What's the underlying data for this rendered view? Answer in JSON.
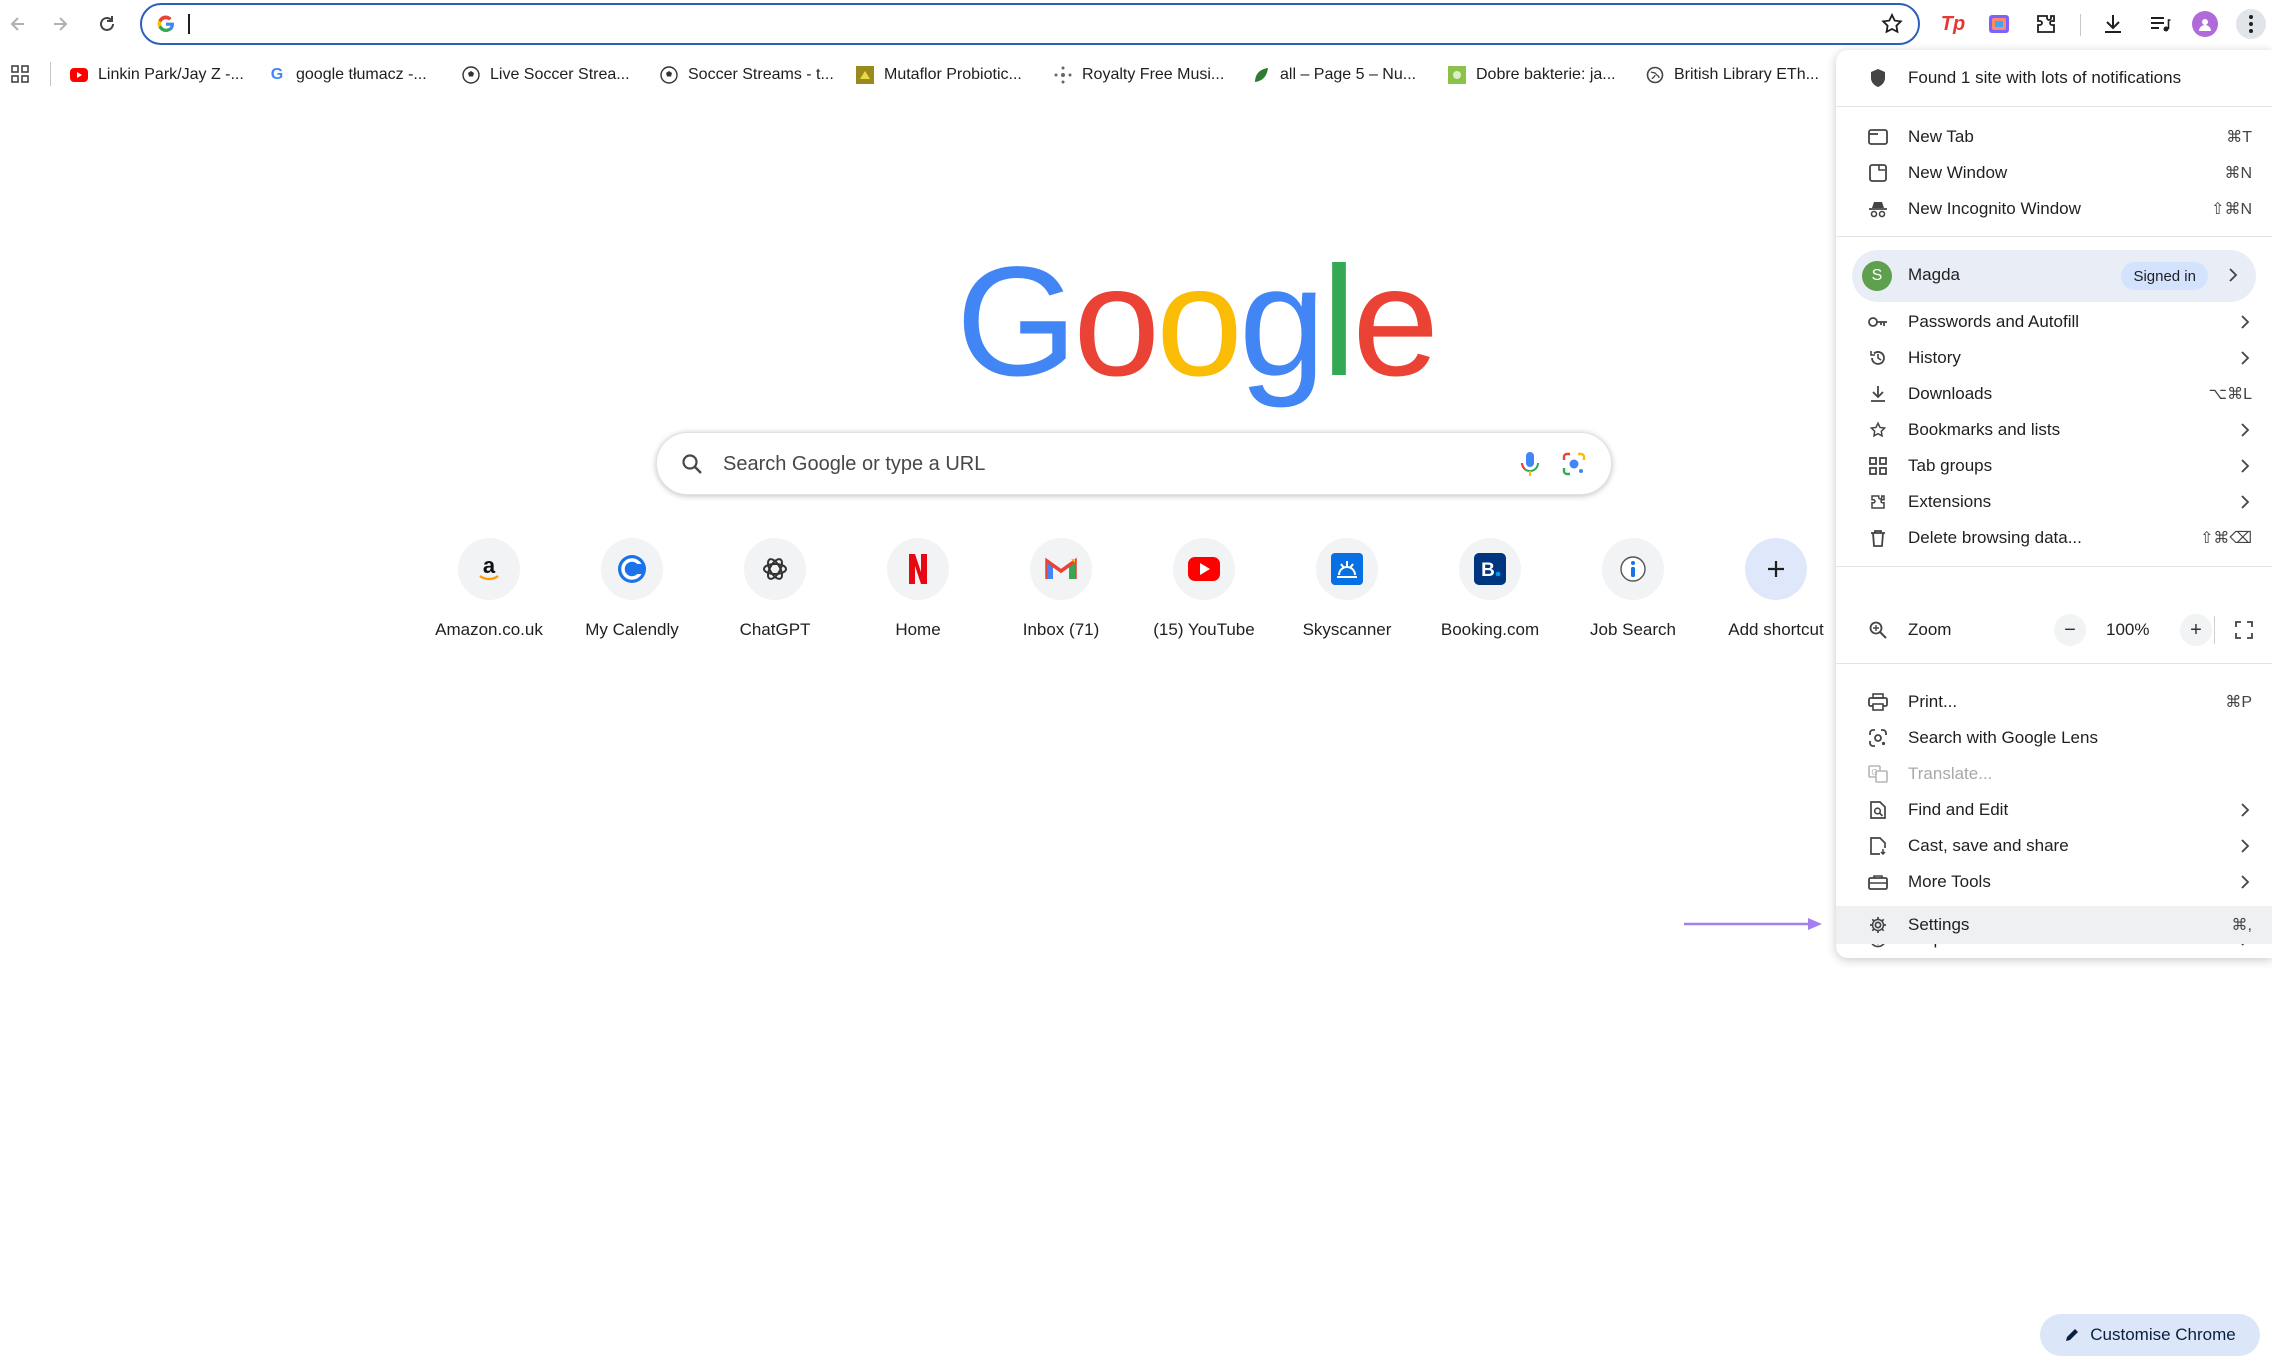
{
  "omnibox": {
    "value": ""
  },
  "bookmarks": [
    {
      "label": "Linkin Park/Jay Z -...",
      "icon": "youtube-icon"
    },
    {
      "label": "google tłumacz -...",
      "icon": "google-icon"
    },
    {
      "label": "Live Soccer Strea...",
      "icon": "soccer-ball-icon"
    },
    {
      "label": "Soccer Streams - t...",
      "icon": "soccer-ball-icon"
    },
    {
      "label": "Mutaflor Probiotic...",
      "icon": "mutaflor-icon"
    },
    {
      "label": "Royalty Free Musi...",
      "icon": "music-icon"
    },
    {
      "label": "all – Page 5 – Nu...",
      "icon": "leaf-icon"
    },
    {
      "label": "Dobre bakterie: ja...",
      "icon": "bacteria-icon"
    },
    {
      "label": "British Library ETh...",
      "icon": "globe-icon"
    }
  ],
  "search": {
    "placeholder": "Search Google or type a URL"
  },
  "shortcuts": [
    {
      "label": "Amazon.co.uk",
      "icon": "amazon-icon"
    },
    {
      "label": "My Calendly",
      "icon": "calendly-icon"
    },
    {
      "label": "ChatGPT",
      "icon": "chatgpt-icon"
    },
    {
      "label": "Home",
      "icon": "netflix-icon"
    },
    {
      "label": "Inbox (71)",
      "icon": "gmail-icon"
    },
    {
      "label": "(15) YouTube",
      "icon": "youtube-icon"
    },
    {
      "label": "Skyscanner",
      "icon": "skyscanner-icon"
    },
    {
      "label": "Booking.com",
      "icon": "booking-icon"
    },
    {
      "label": "Job Search",
      "icon": "job-search-icon"
    },
    {
      "label": "Add shortcut",
      "icon": "plus-icon"
    }
  ],
  "menu": {
    "notification": "Found 1 site with lots of notifications",
    "new_tab": {
      "label": "New Tab",
      "shortcut": "⌘T"
    },
    "new_window": {
      "label": "New Window",
      "shortcut": "⌘N"
    },
    "new_incognito": {
      "label": "New Incognito Window",
      "shortcut": "⇧⌘N"
    },
    "profile": {
      "initial": "S",
      "name": "Magda",
      "status": "Signed in"
    },
    "passwords": {
      "label": "Passwords and Autofill"
    },
    "history": {
      "label": "History"
    },
    "downloads": {
      "label": "Downloads",
      "shortcut": "⌥⌘L"
    },
    "bookmarks": {
      "label": "Bookmarks and lists"
    },
    "tab_groups": {
      "label": "Tab groups"
    },
    "extensions": {
      "label": "Extensions"
    },
    "delete_data": {
      "label": "Delete browsing data...",
      "shortcut": "⇧⌘⌫"
    },
    "zoom": {
      "label": "Zoom",
      "minus": "−",
      "value": "100%",
      "plus": "+"
    },
    "print": {
      "label": "Print...",
      "shortcut": "⌘P"
    },
    "lens": {
      "label": "Search with Google Lens"
    },
    "translate": {
      "label": "Translate..."
    },
    "find_edit": {
      "label": "Find and Edit"
    },
    "cast": {
      "label": "Cast, save and share"
    },
    "more_tools": {
      "label": "More Tools"
    },
    "help": {
      "label": "Help"
    },
    "settings": {
      "label": "Settings",
      "shortcut": "⌘,"
    }
  },
  "customise": {
    "label": "Customise Chrome"
  },
  "colors": {
    "accent": "#1a73e8",
    "arrow": "#a57ff0",
    "omnibox_border": "#2c5fbf"
  }
}
